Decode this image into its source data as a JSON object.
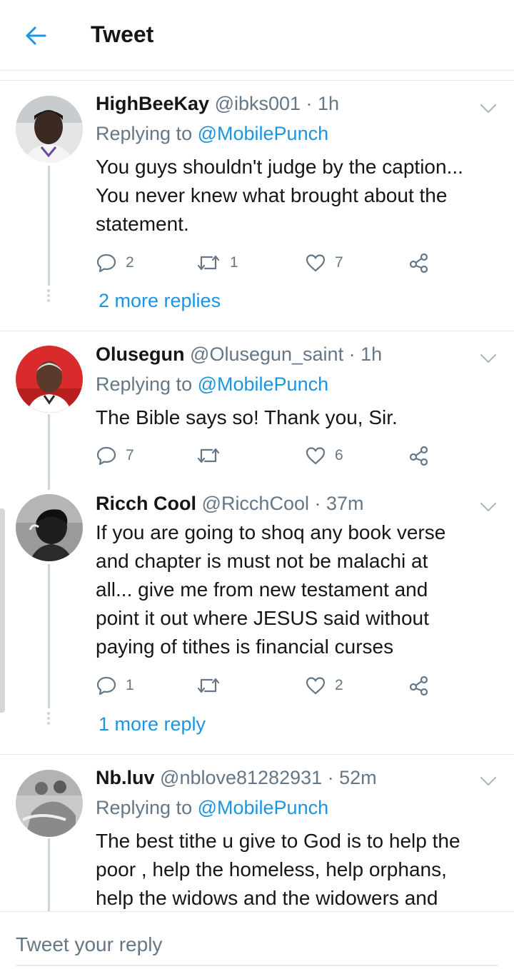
{
  "header": {
    "title": "Tweet"
  },
  "reply_box": {
    "placeholder": "Tweet your reply"
  },
  "tweets": [
    {
      "name": "HighBeeKay",
      "handle": "@ibks001 · 1h",
      "replying_prefix": "Replying to ",
      "replying_to": "@MobilePunch",
      "lines": [
        "You guys shouldn't judge by the caption...",
        "You never knew what brought about the",
        "statement."
      ],
      "replies": "2",
      "retweets": "1",
      "likes": "7",
      "more_replies": "2 more replies"
    },
    {
      "name": "Olusegun",
      "handle": "@Olusegun_saint · 1h",
      "replying_prefix": "Replying to ",
      "replying_to": "@MobilePunch",
      "lines": [
        "The Bible says so! Thank you, Sir."
      ],
      "replies": "7",
      "retweets": "",
      "likes": "6"
    },
    {
      "name": "Ricch Cool",
      "handle": "@RicchCool · 37m",
      "lines": [
        "If you are going to shoq any book verse",
        "and chapter is must not be malachi at",
        "all... give me from new testament and",
        "point it out where JESUS said without",
        "paying of tithes is financial curses"
      ],
      "replies": "1",
      "retweets": "",
      "likes": "2",
      "more_replies": "1 more reply"
    },
    {
      "name": "Nb.luv",
      "handle": "@nblove81282931 · 52m",
      "replying_prefix": "Replying to ",
      "replying_to": "@MobilePunch",
      "lines": [
        "The best tithe u give to God is to help the",
        "poor , help the homeless, help orphans,",
        "help the widows and the widowers and"
      ]
    }
  ],
  "icons": {
    "back": "arrow-left-icon",
    "caret": "chevron-down-icon",
    "reply": "speech-bubble-icon",
    "retweet": "retweet-icon",
    "like": "heart-icon",
    "share": "share-icon"
  },
  "colors": {
    "accent": "#1b95e0",
    "secondary_text": "#657786",
    "divider": "#e6ecf0",
    "thread_line": "#ccd6dd"
  }
}
